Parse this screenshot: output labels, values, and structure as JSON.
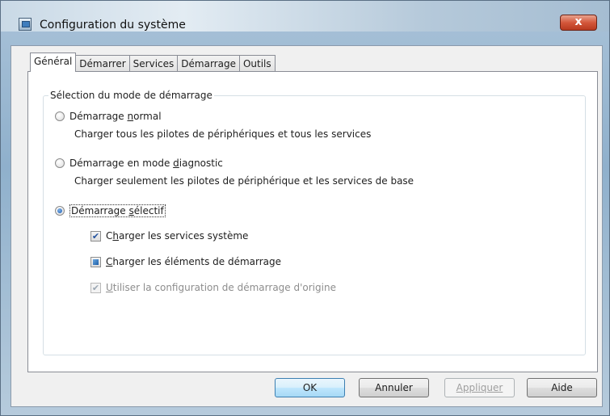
{
  "window": {
    "title": "Configuration du système",
    "close_label": "x"
  },
  "tabs": [
    {
      "label": "Général",
      "active": true
    },
    {
      "label": "Démarrer",
      "active": false
    },
    {
      "label": "Services",
      "active": false
    },
    {
      "label": "Démarrage",
      "active": false
    },
    {
      "label": "Outils",
      "active": false
    }
  ],
  "startup_group": {
    "label": "Sélection du mode de démarrage",
    "normal": {
      "label_pre": "Démarrage ",
      "label_accel": "n",
      "label_post": "ormal",
      "description": "Charger tous les pilotes de périphériques et tous les services",
      "selected": false
    },
    "diagnostic": {
      "label_pre": "Démarrage en mode ",
      "label_accel": "d",
      "label_post": "iagnostic",
      "description": "Charger seulement les pilotes de périphérique et les services de base",
      "selected": false
    },
    "selective": {
      "label_pre": "Démarrage ",
      "label_accel": "s",
      "label_post": "électif",
      "selected": true,
      "options": {
        "system_services": {
          "label_pre": "C",
          "label_accel": "h",
          "label_post": "arger les services système",
          "state": "checked"
        },
        "startup_items": {
          "label_pre": "",
          "label_accel": "C",
          "label_post": "harger les éléments de démarrage",
          "state": "indeterminate"
        },
        "original_config": {
          "label_pre": "",
          "label_accel": "U",
          "label_post": "tiliser la configuration de démarrage d'origine",
          "state": "checked-disabled"
        }
      }
    }
  },
  "buttons": {
    "ok": "OK",
    "cancel": "Annuler",
    "apply": "Appliquer",
    "help": "Aide"
  }
}
